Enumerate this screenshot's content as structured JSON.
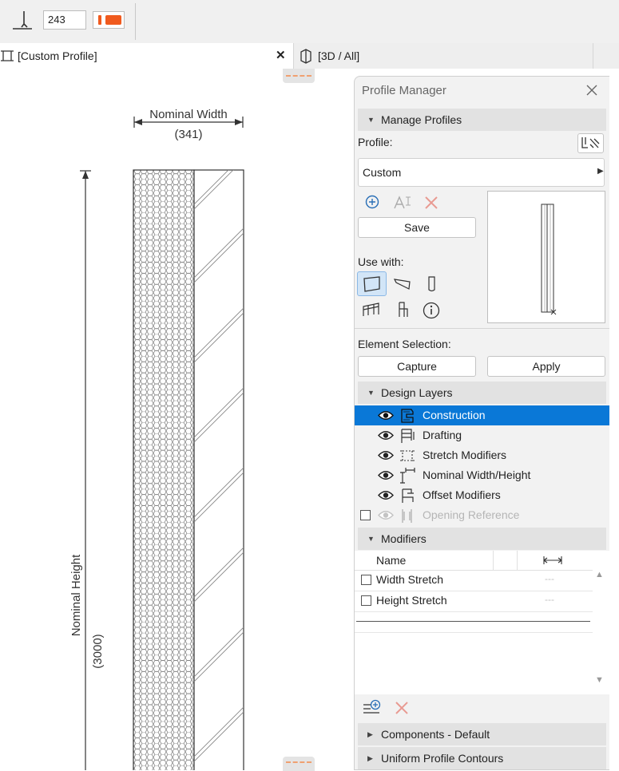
{
  "toolbar": {
    "pen_number": "243",
    "pen_icon": "pen-icon",
    "pen_color": "#f05a1e"
  },
  "tabs": [
    {
      "label": "[Custom Profile]",
      "icon": "profile-tab-icon",
      "close": "✕"
    },
    {
      "label": "[3D / All]",
      "icon": "3d-view-icon"
    }
  ],
  "drawing": {
    "nominal_width_label": "Nominal Width",
    "nominal_width_value": "(341)",
    "nominal_height_label": "Nominal Height",
    "nominal_height_value": "(3000)"
  },
  "panel": {
    "title": "Profile Manager",
    "manage_section": "Manage Profiles",
    "profile_label": "Profile:",
    "profile_value": "Custom",
    "save_label": "Save",
    "use_with_label": "Use with:",
    "element_selection_label": "Element Selection:",
    "capture_label": "Capture",
    "apply_label": "Apply",
    "design_layers_section": "Design Layers",
    "layers": [
      {
        "name": "Construction",
        "selected": true
      },
      {
        "name": "Drafting"
      },
      {
        "name": "Stretch Modifiers"
      },
      {
        "name": "Nominal Width/Height"
      },
      {
        "name": "Offset Modifiers"
      },
      {
        "name": "Opening Reference",
        "disabled": true
      }
    ],
    "modifiers_section": "Modifiers",
    "modifiers_header": "Name",
    "modifiers": [
      {
        "name": "Width Stretch",
        "value": "---"
      },
      {
        "name": "Height Stretch",
        "value": "---"
      }
    ],
    "components_section": "Components - Default",
    "uniform_section": "Uniform Profile Contours"
  },
  "colors": {
    "selection": "#0a78d7",
    "delete": "#e05a50",
    "accent_orange": "#f05a1e"
  }
}
